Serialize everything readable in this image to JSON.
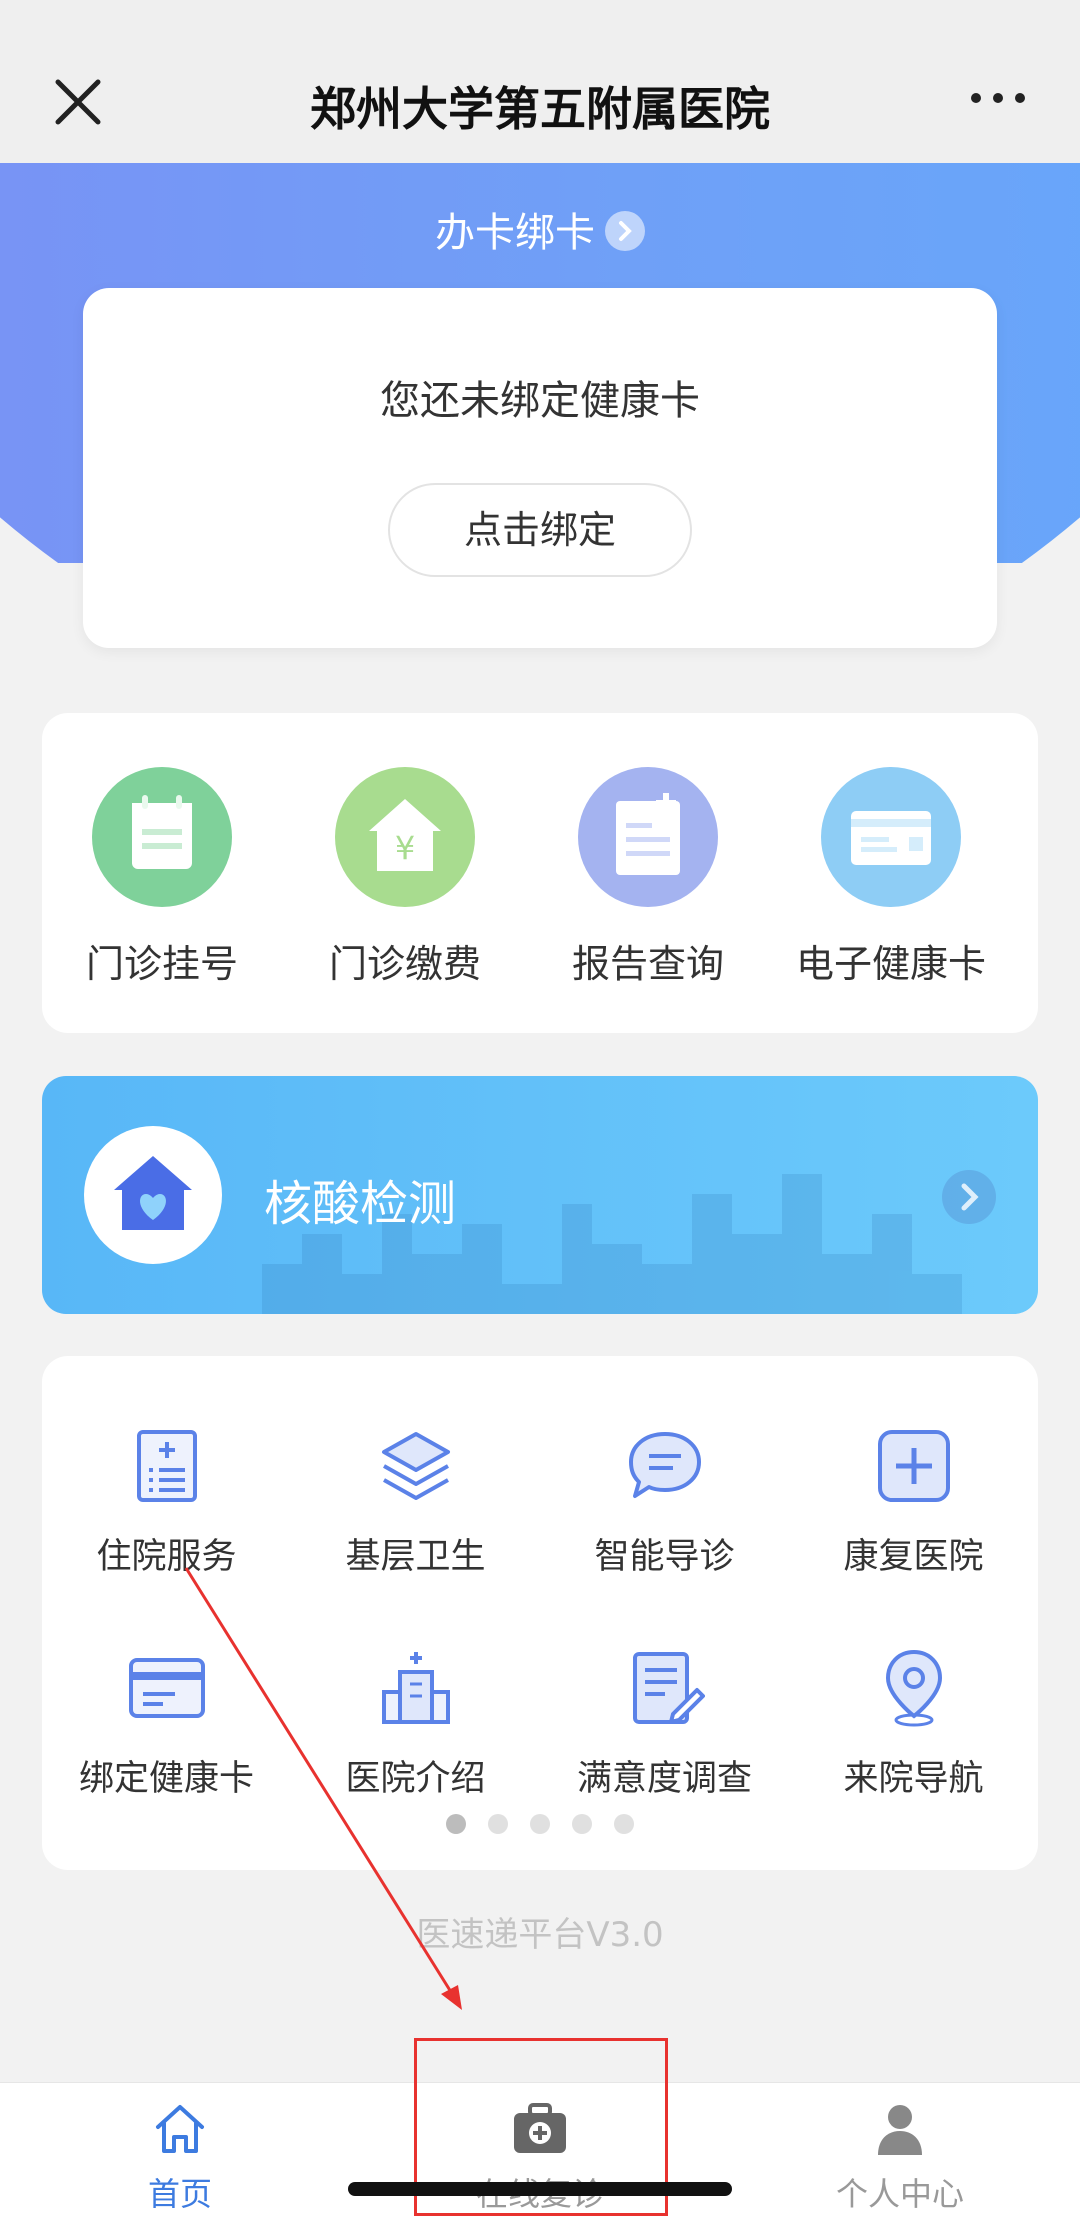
{
  "topbar": {
    "title": "郑州大学第五附属医院",
    "close_icon": "close-icon",
    "more_icon": "more-icon"
  },
  "hero": {
    "title": "办卡绑卡",
    "colors": {
      "start": "#7d8cf4",
      "end": "#63aafc"
    }
  },
  "bind_card": {
    "message": "您还未绑定健康卡",
    "button_label": "点击绑定"
  },
  "quick_actions": [
    {
      "label": "门诊挂号",
      "icon": "calendar-icon",
      "color": "#7fd19a"
    },
    {
      "label": "门诊缴费",
      "icon": "yuan-house-icon",
      "color": "#a8dc8f"
    },
    {
      "label": "报告查询",
      "icon": "report-icon",
      "color": "#a4b3f0"
    },
    {
      "label": "电子健康卡",
      "icon": "card-icon",
      "color": "#8ecdf5"
    }
  ],
  "covid_banner": {
    "label": "核酸检测",
    "icon": "heart-house-icon"
  },
  "services": [
    {
      "label": "住院服务",
      "icon": "clipboard-plus-icon"
    },
    {
      "label": "基层卫生",
      "icon": "layers-icon"
    },
    {
      "label": "智能导诊",
      "icon": "chat-icon"
    },
    {
      "label": "康复医院",
      "icon": "plus-square-icon"
    },
    {
      "label": "绑定健康卡",
      "icon": "credit-card-icon"
    },
    {
      "label": "医院介绍",
      "icon": "hospital-icon"
    },
    {
      "label": "满意度调查",
      "icon": "survey-icon"
    },
    {
      "label": "来院导航",
      "icon": "location-pin-icon"
    }
  ],
  "pagination": {
    "total": 5,
    "active": 1
  },
  "footer": {
    "text": "医速递平台V3.0"
  },
  "tabbar": [
    {
      "label": "首页",
      "icon": "home-icon",
      "active": true
    },
    {
      "label": "在线复诊",
      "icon": "medical-kit-icon",
      "active": false
    },
    {
      "label": "个人中心",
      "icon": "user-icon",
      "active": false
    }
  ],
  "colors": {
    "accent": "#3d7be0",
    "annotation": "#e8322f"
  }
}
